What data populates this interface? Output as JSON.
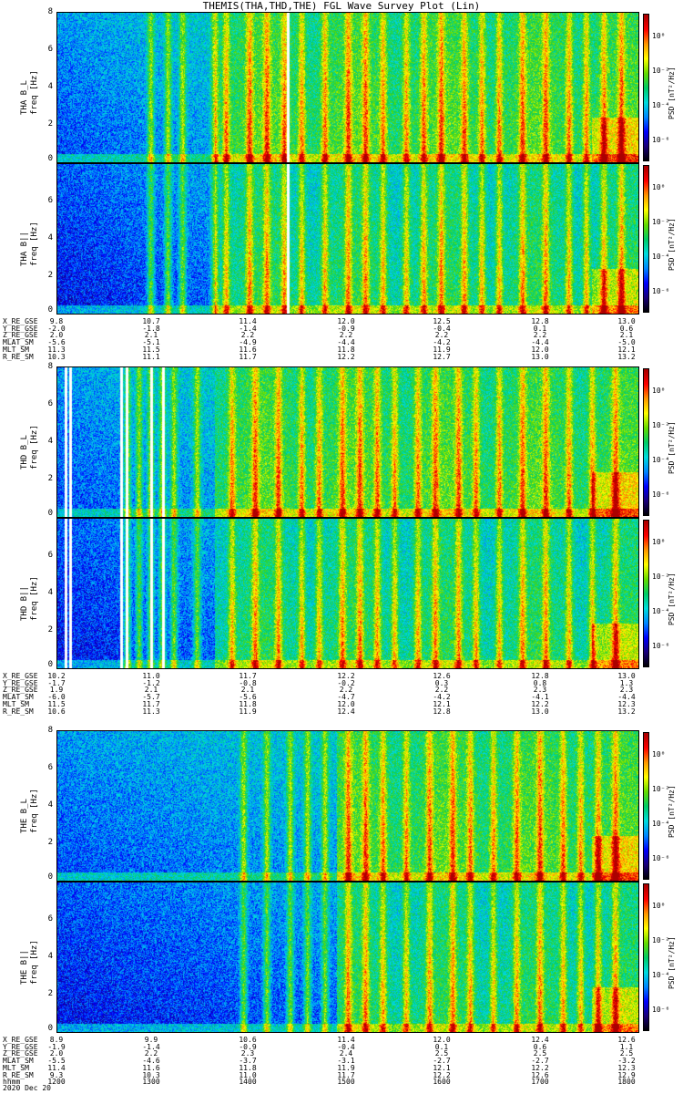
{
  "title": "THEMIS(THA,THD,THE) FGL Wave Survey Plot (Lin)",
  "colors": {
    "colormap": [
      "#000000",
      "#1a007a",
      "#0000ff",
      "#0088ff",
      "#00dddd",
      "#00cc66",
      "#66dd00",
      "#ffff00",
      "#ff9900",
      "#ff0000",
      "#aa0000"
    ]
  },
  "chart_data": [
    {
      "type": "heatmap",
      "group": "THA",
      "panels": [
        {
          "name": "THA B L",
          "ylabel": "THA B_L\nfreq [Hz]",
          "ylim": [
            0,
            8
          ],
          "yticks": [
            "0",
            "2",
            "4",
            "6",
            "8"
          ],
          "colorbar_label": "PSD [nT²/Hz]",
          "colorbar_ticks": [
            "10⁰",
            "10⁻²",
            "10⁻⁴",
            "10⁻⁶"
          ]
        },
        {
          "name": "THA B||",
          "ylabel": "THA B||\nfreq [Hz]",
          "ylim": [
            0,
            8
          ],
          "yticks": [
            "0",
            "2",
            "4",
            "6"
          ],
          "colorbar_label": "PSD [nT²/Hz]",
          "colorbar_ticks": [
            "10⁰",
            "10⁻²",
            "10⁻⁴",
            "10⁻⁶"
          ]
        }
      ],
      "orbit_rows": [
        "X_RE_GSE",
        "Y_RE_GSE",
        "Z_RE_GSE",
        "MLAT_SM",
        "MLT_SM",
        "R_RE_SM"
      ],
      "orbit_values": [
        [
          "9.8",
          "10.7",
          "11.4",
          "12.0",
          "12.5",
          "12.8",
          "13.0"
        ],
        [
          "-2.0",
          "-1.8",
          "-1.4",
          "-0.9",
          "-0.4",
          "0.1",
          "0.6"
        ],
        [
          "2.0",
          "2.1",
          "2.2",
          "2.2",
          "2.2",
          "2.2",
          "2.1"
        ],
        [
          "-5.6",
          "-5.1",
          "-4.9",
          "-4.4",
          "-4.2",
          "-4.4",
          "-5.0"
        ],
        [
          "11.3",
          "11.5",
          "11.6",
          "11.8",
          "11.9",
          "12.0",
          "12.1"
        ],
        [
          "10.3",
          "11.1",
          "11.7",
          "12.2",
          "12.7",
          "13.0",
          "13.2"
        ]
      ],
      "features": {
        "quiet_end": 0.27,
        "bursts": [
          0.16,
          0.19,
          0.215,
          0.27,
          0.29,
          0.33,
          0.36,
          0.39,
          0.42,
          0.46,
          0.5,
          0.53,
          0.56,
          0.6,
          0.63,
          0.66,
          0.7,
          0.73,
          0.76,
          0.8,
          0.84,
          0.88,
          0.91,
          0.94,
          0.97
        ],
        "gaps": [
          0.395
        ]
      }
    },
    {
      "type": "heatmap",
      "group": "THD",
      "panels": [
        {
          "name": "THD B L",
          "ylabel": "THD B_L\nfreq [Hz]",
          "ylim": [
            0,
            8
          ],
          "yticks": [
            "0",
            "2",
            "4",
            "6",
            "8"
          ],
          "colorbar_label": "PSD [nT²/Hz]",
          "colorbar_ticks": [
            "10⁰",
            "10⁻²",
            "10⁻⁴",
            "10⁻⁶"
          ]
        },
        {
          "name": "THD B||",
          "ylabel": "THD B||\nfreq [Hz]",
          "ylim": [
            0,
            8
          ],
          "yticks": [
            "0",
            "2",
            "4",
            "6"
          ],
          "colorbar_label": "PSD [nT²/Hz]",
          "colorbar_ticks": [
            "10⁰",
            "10⁻²",
            "10⁻⁴",
            "10⁻⁶"
          ]
        }
      ],
      "orbit_rows": [
        "X_RE_GSE",
        "Y_RE_GSE",
        "Z_RE_GSE",
        "MLAT_SM",
        "MLT_SM",
        "R_RE_SM"
      ],
      "orbit_values": [
        [
          "10.2",
          "11.0",
          "11.7",
          "12.2",
          "12.6",
          "12.8",
          "13.0"
        ],
        [
          "-1.7",
          "-1.2",
          "-0.8",
          "-0.2",
          "0.3",
          "0.8",
          "1.3"
        ],
        [
          "1.9",
          "2.1",
          "2.1",
          "2.2",
          "2.2",
          "2.3",
          "2.3"
        ],
        [
          "-6.0",
          "-5.7",
          "-5.6",
          "-4.7",
          "-4.2",
          "-4.1",
          "-4.4"
        ],
        [
          "11.5",
          "11.7",
          "11.8",
          "12.0",
          "12.1",
          "12.2",
          "12.3"
        ],
        [
          "10.6",
          "11.3",
          "11.9",
          "12.4",
          "12.8",
          "13.0",
          "13.2"
        ]
      ],
      "features": {
        "quiet_end": 0.27,
        "bursts": [
          0.12,
          0.14,
          0.16,
          0.18,
          0.2,
          0.24,
          0.3,
          0.34,
          0.38,
          0.42,
          0.45,
          0.49,
          0.52,
          0.55,
          0.58,
          0.62,
          0.65,
          0.69,
          0.72,
          0.76,
          0.8,
          0.84,
          0.88,
          0.92,
          0.96
        ],
        "gaps": [
          0.012,
          0.02,
          0.108,
          0.118,
          0.16,
          0.18
        ]
      }
    },
    {
      "type": "heatmap",
      "group": "THE",
      "panels": [
        {
          "name": "THE B L",
          "ylabel": "THE B_L\nfreq [Hz]",
          "ylim": [
            0,
            8
          ],
          "yticks": [
            "0",
            "2",
            "4",
            "6",
            "8"
          ],
          "colorbar_label": "PSD [nT²/Hz]",
          "colorbar_ticks": [
            "10⁰",
            "10⁻²",
            "10⁻⁴",
            "10⁻⁶"
          ]
        },
        {
          "name": "THE B||",
          "ylabel": "THE B||\nfreq [Hz]",
          "ylim": [
            0,
            8
          ],
          "yticks": [
            "0",
            "2",
            "4",
            "6"
          ],
          "colorbar_label": "PSD [nT²/Hz]",
          "colorbar_ticks": [
            "10⁰",
            "10⁻²",
            "10⁻⁴",
            "10⁻⁶"
          ]
        }
      ],
      "orbit_rows": [
        "X_RE_GSE",
        "Y_RE_GSE",
        "Z_RE_GSE",
        "MLAT_SM",
        "MLT_SM",
        "R_RE_SM",
        "hhmm"
      ],
      "orbit_values": [
        [
          "8.9",
          "9.9",
          "10.6",
          "11.4",
          "12.0",
          "12.4",
          "12.6"
        ],
        [
          "-1.9",
          "-1.4",
          "-0.9",
          "-0.4",
          "0.1",
          "0.6",
          "1.1"
        ],
        [
          "2.0",
          "2.2",
          "2.3",
          "2.4",
          "2.5",
          "2.5",
          "2.5"
        ],
        [
          "-5.5",
          "-4.6",
          "-3.7",
          "-3.1",
          "-2.7",
          "-2.7",
          "-3.2"
        ],
        [
          "11.4",
          "11.6",
          "11.8",
          "11.9",
          "12.1",
          "12.2",
          "12.3"
        ],
        [
          "9.3",
          "10.3",
          "11.0",
          "11.7",
          "12.2",
          "12.6",
          "12.9"
        ],
        [
          "1200",
          "1300",
          "1400",
          "1500",
          "1600",
          "1700",
          "1800"
        ]
      ],
      "features": {
        "quiet_end": 0.48,
        "bursts": [
          0.32,
          0.36,
          0.4,
          0.43,
          0.46,
          0.5,
          0.53,
          0.56,
          0.6,
          0.64,
          0.68,
          0.71,
          0.75,
          0.79,
          0.83,
          0.87,
          0.9,
          0.93,
          0.96
        ],
        "gaps": []
      }
    }
  ],
  "footer": {
    "date": "2020 Dec 20"
  }
}
